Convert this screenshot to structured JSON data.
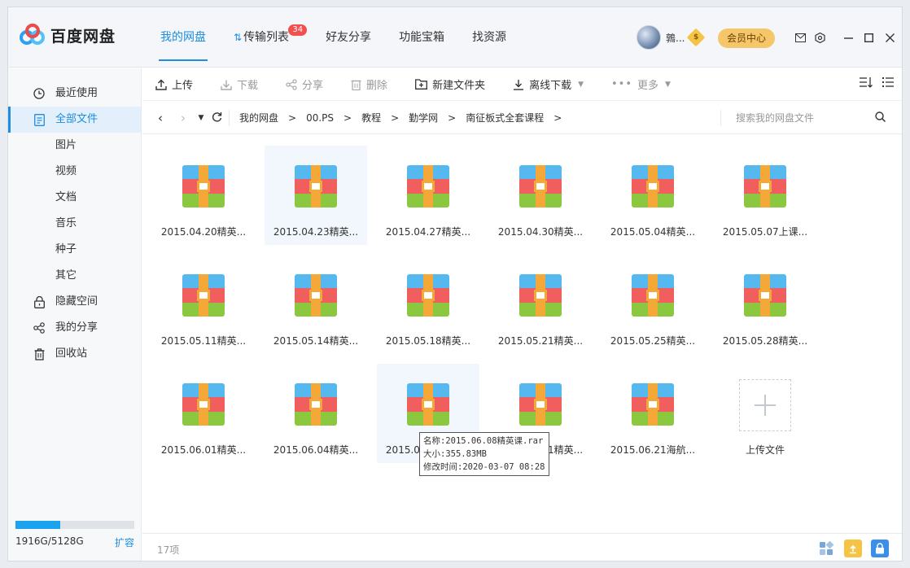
{
  "app": {
    "name": "百度网盘"
  },
  "nav": {
    "tabs": [
      {
        "label": "我的网盘",
        "active": true
      },
      {
        "label": "传输列表",
        "badge": "34"
      },
      {
        "label": "好友分享"
      },
      {
        "label": "功能宝箱"
      },
      {
        "label": "找资源"
      }
    ]
  },
  "user": {
    "name": "鶉...",
    "vip_icon": "vip-diamond-icon",
    "member_button": "会员中心"
  },
  "window_controls": [
    "mail-icon",
    "settings-icon",
    "minimize-icon",
    "maximize-icon",
    "close-icon"
  ],
  "sidebar": {
    "items": [
      {
        "label": "最近使用",
        "icon": "clock-icon"
      },
      {
        "label": "全部文件",
        "icon": "document-icon",
        "active": true
      },
      {
        "label": "图片",
        "sub": true
      },
      {
        "label": "视频",
        "sub": true
      },
      {
        "label": "文档",
        "sub": true
      },
      {
        "label": "音乐",
        "sub": true
      },
      {
        "label": "种子",
        "sub": true
      },
      {
        "label": "其它",
        "sub": true
      },
      {
        "label": "隐藏空间",
        "icon": "lock-icon"
      },
      {
        "label": "我的分享",
        "icon": "share-icon"
      },
      {
        "label": "回收站",
        "icon": "trash-icon"
      }
    ],
    "quota": {
      "text": "1916G/5128G",
      "expand": "扩容",
      "used_fraction": 0.374
    }
  },
  "toolbar": {
    "upload": "上传",
    "download": "下载",
    "share": "分享",
    "delete": "删除",
    "new_folder": "新建文件夹",
    "offline_download": "离线下载",
    "more": "更多"
  },
  "breadcrumb": [
    "我的网盘",
    "00.PS",
    "教程",
    "勤学网",
    "南征板式全套课程"
  ],
  "search": {
    "placeholder": "搜索我的网盘文件"
  },
  "files": [
    "2015.04.20精英...",
    "2015.04.23精英...",
    "2015.04.27精英...",
    "2015.04.30精英...",
    "2015.05.04精英...",
    "2015.05.07上课...",
    "2015.05.11精英...",
    "2015.05.14精英...",
    "2015.05.18精英...",
    "2015.05.21精英...",
    "2015.05.25精英...",
    "2015.05.28精英...",
    "2015.06.01精英...",
    "2015.06.04精英...",
    "2015.06.08精英...",
    "2015.06.11精英...",
    "2015.06.21海航..."
  ],
  "upload_tile": {
    "label": "上传文件"
  },
  "tooltip": {
    "name": "名称:2015.06.08精英课.rar",
    "size": "大小:355.83MB",
    "modified": "修改时间:2020-03-07 08:28"
  },
  "status": {
    "count": "17项"
  }
}
